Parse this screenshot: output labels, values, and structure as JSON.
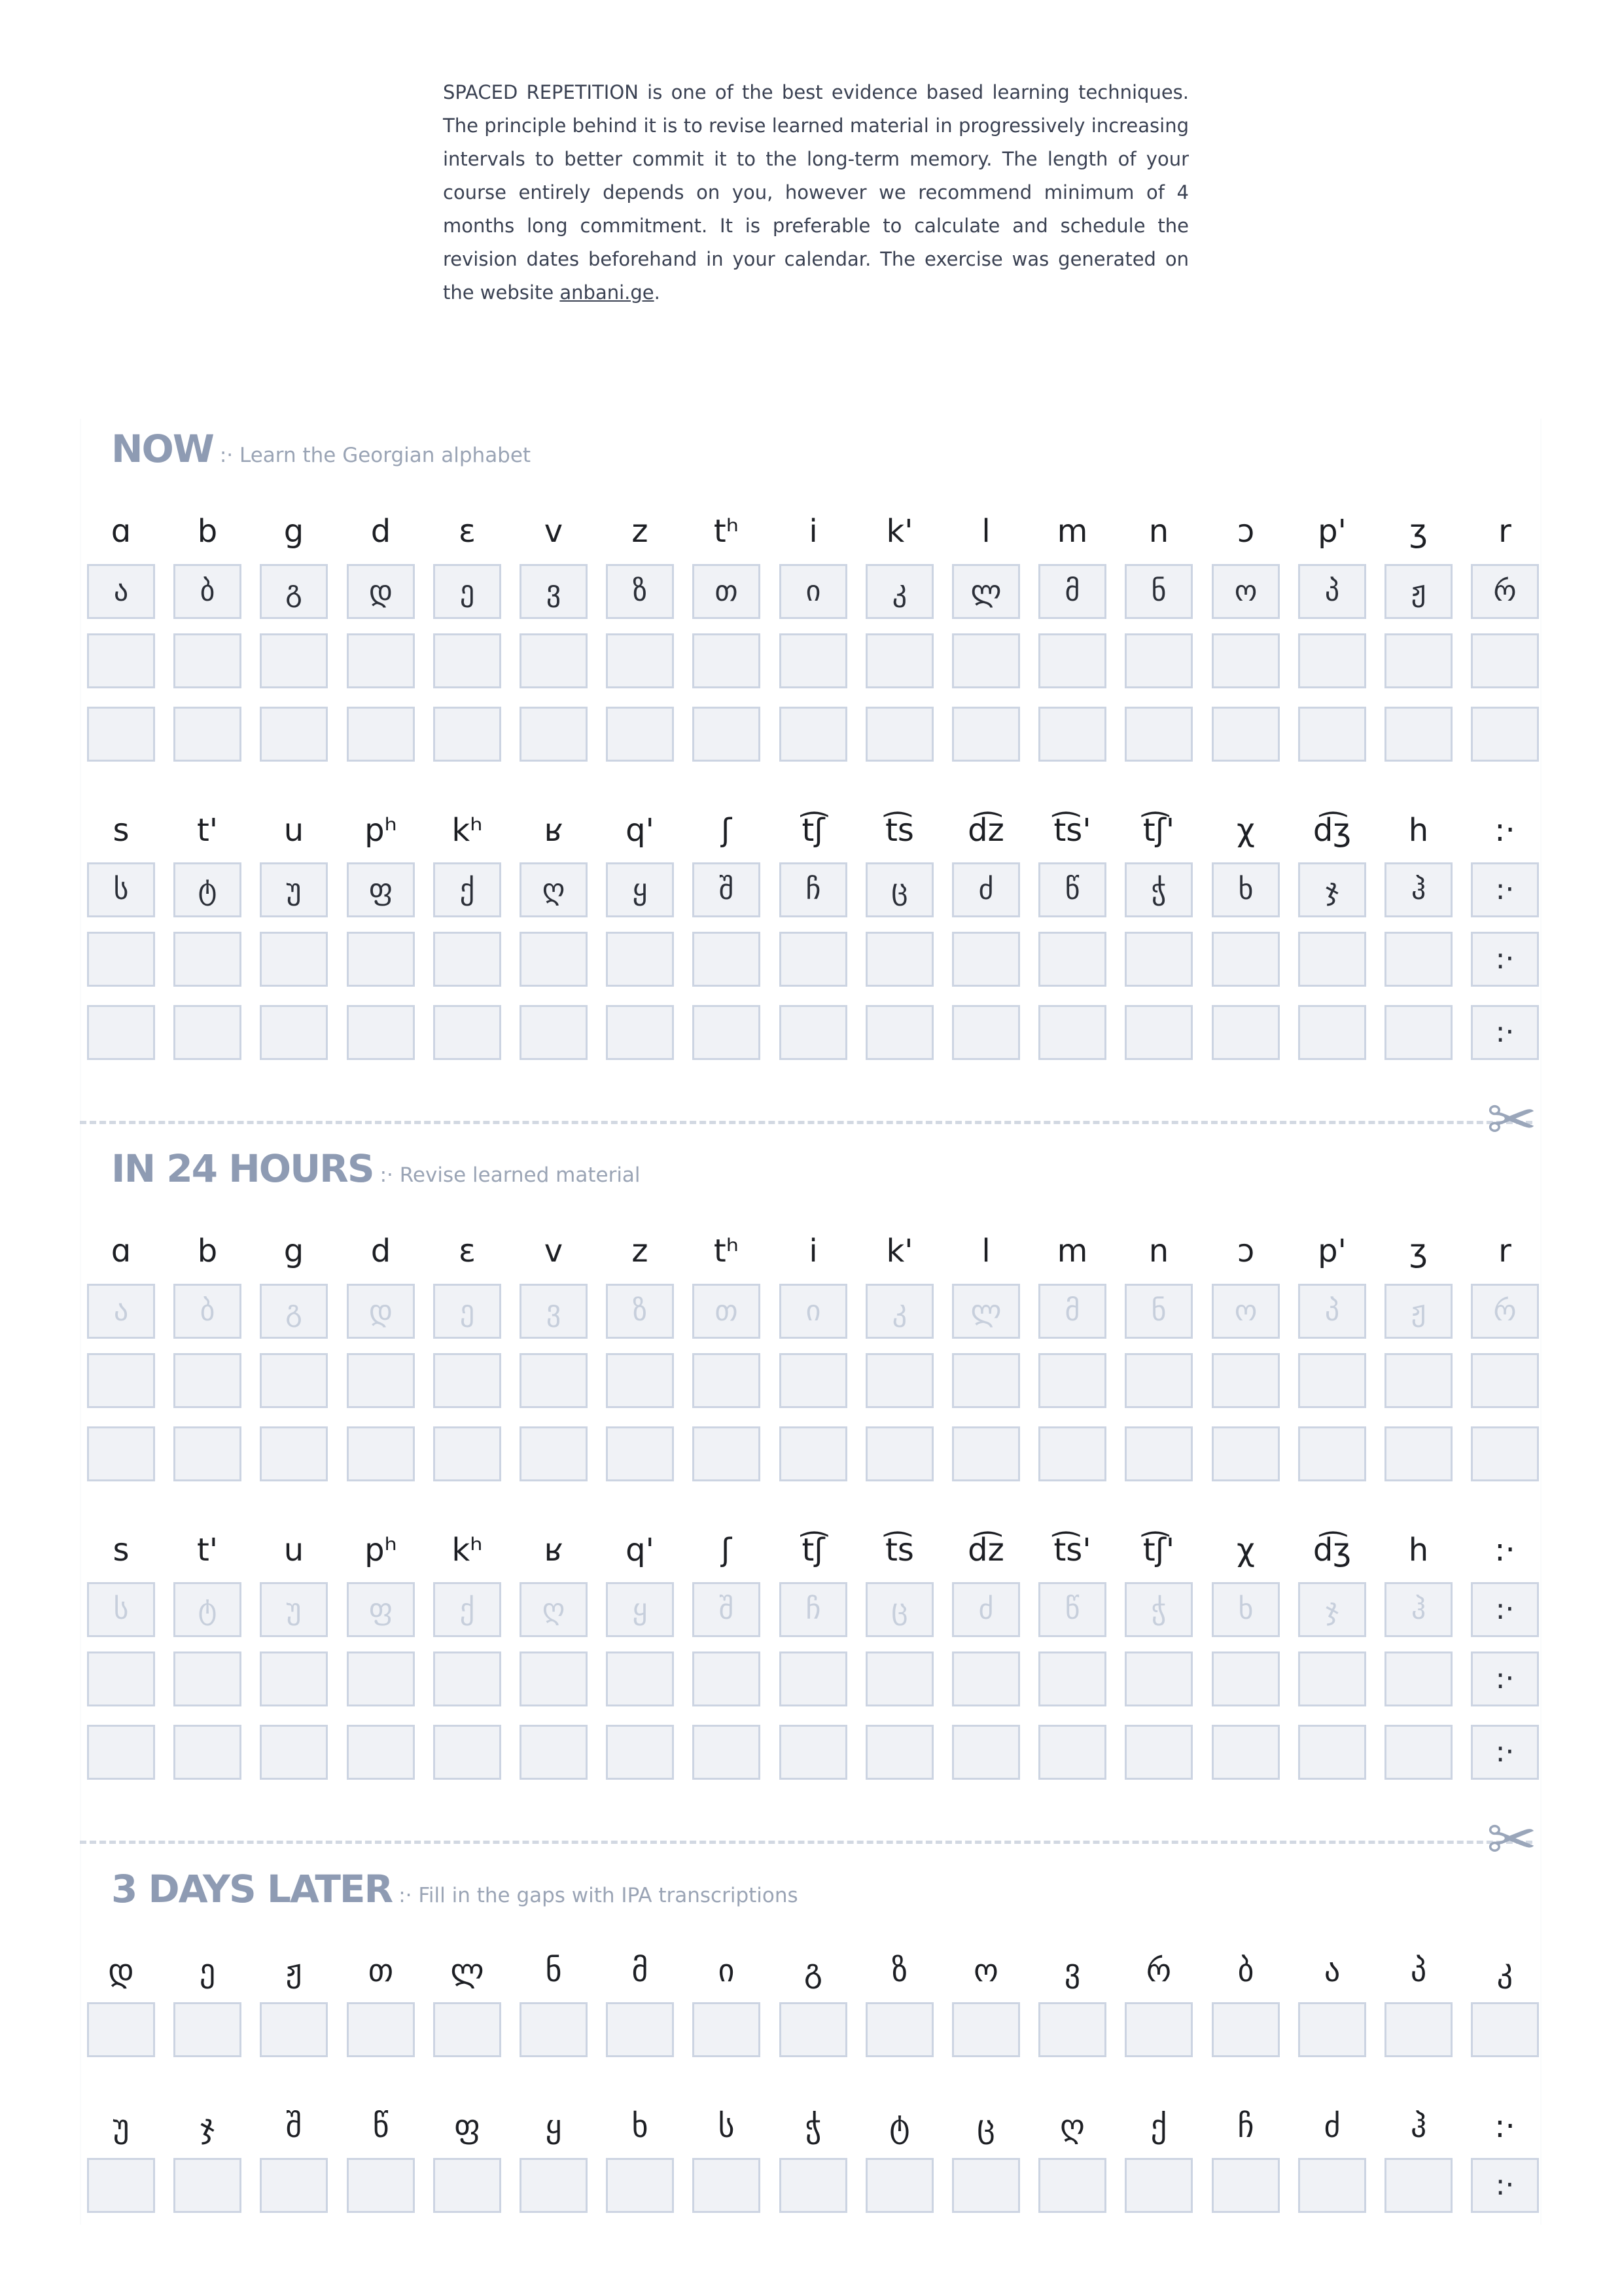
{
  "intro": {
    "text": "SPACED REPETITION is one of the best evidence based learning techniques. The principle behind it is to revise learned material in progressively increasing intervals to better commit it to the long-term memory. The length of your course entirely depends on you, however we recommend minimum of 4 months long commitment. It is preferable to calculate and schedule the revision dates beforehand in your calendar. The exercise was generated on the website ",
    "link": "anbani.ge",
    "end": "."
  },
  "sections": {
    "now": {
      "title": "NOW",
      "subtitle": ":· Learn the Georgian alphabet"
    },
    "h24": {
      "title": "IN 24 HOURS",
      "subtitle": ":· Revise learned material"
    },
    "d3": {
      "title": "3 DAYS LATER",
      "subtitle": ":· Fill in the gaps with IPA transcriptions"
    }
  },
  "ipa_row1": [
    "ɑ",
    "b",
    "g",
    "d",
    "ɛ",
    "v",
    "z",
    "tʰ",
    "i",
    "k'",
    "l",
    "m",
    "n",
    "ɔ",
    "p'",
    "ʒ",
    "r"
  ],
  "geo_row1": [
    "ა",
    "ბ",
    "გ",
    "დ",
    "ე",
    "ვ",
    "ზ",
    "თ",
    "ი",
    "კ",
    "ლ",
    "მ",
    "ნ",
    "ო",
    "პ",
    "ჟ",
    "რ"
  ],
  "ipa_row2": [
    "s",
    "t'",
    "u",
    "pʰ",
    "kʰ",
    "ʁ",
    "q'",
    "ʃ",
    "t͡ʃ",
    "t͡s",
    "d͡z",
    "t͡s'",
    "t͡ʃ'",
    "χ",
    "d͡ʒ",
    "h",
    ":·"
  ],
  "geo_row2": [
    "ს",
    "ტ",
    "უ",
    "ფ",
    "ქ",
    "ღ",
    "ყ",
    "შ",
    "ჩ",
    "ც",
    "ძ",
    "წ",
    "ჭ",
    "ხ",
    "ჯ",
    "ჰ",
    ":·"
  ],
  "quiz_row1": [
    "დ",
    "ე",
    "ჟ",
    "თ",
    "ლ",
    "ნ",
    "მ",
    "ი",
    "გ",
    "ზ",
    "ო",
    "ვ",
    "რ",
    "ბ",
    "ა",
    "პ",
    "კ"
  ],
  "quiz_row2": [
    "უ",
    "ჯ",
    "შ",
    "წ",
    "ფ",
    "ყ",
    "ხ",
    "ს",
    "ჭ",
    "ტ",
    "ც",
    "ღ",
    "ქ",
    "ჩ",
    "ძ",
    "ჰ",
    ":·"
  ],
  "end_mark": ":·",
  "scissors_icon": "✂"
}
